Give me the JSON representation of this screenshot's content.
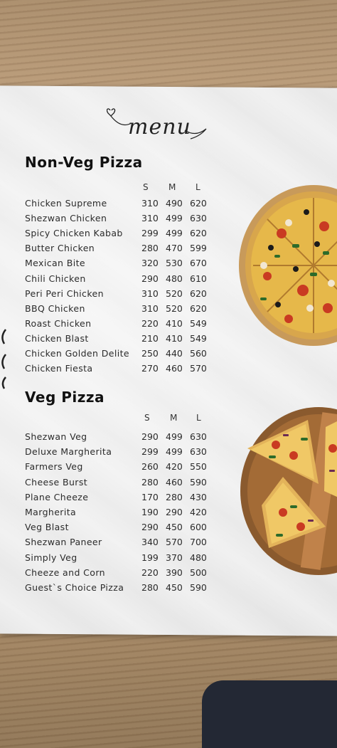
{
  "menu": {
    "title": "menu",
    "sizes": [
      "S",
      "M",
      "L"
    ],
    "non_veg": {
      "title": "Non-Veg Pizza",
      "items": [
        {
          "name": "Chicken Supreme",
          "s": "310",
          "m": "490",
          "l": "620"
        },
        {
          "name": "Shezwan Chicken",
          "s": "310",
          "m": "499",
          "l": "630"
        },
        {
          "name": "Spicy Chicken Kabab",
          "s": "299",
          "m": "499",
          "l": "620"
        },
        {
          "name": "Butter Chicken",
          "s": "280",
          "m": "470",
          "l": "599"
        },
        {
          "name": "Mexican Bite",
          "s": "320",
          "m": "530",
          "l": "670"
        },
        {
          "name": "Chili Chicken",
          "s": "290",
          "m": "480",
          "l": "610"
        },
        {
          "name": "Peri Peri Chicken",
          "s": "310",
          "m": "520",
          "l": "620"
        },
        {
          "name": "BBQ Chicken",
          "s": "310",
          "m": "520",
          "l": "620"
        },
        {
          "name": "Roast Chicken",
          "s": "220",
          "m": "410",
          "l": "549"
        },
        {
          "name": "Chicken Blast",
          "s": "210",
          "m": "410",
          "l": "549"
        },
        {
          "name": "Chicken Golden Delite",
          "s": "250",
          "m": "440",
          "l": "560"
        },
        {
          "name": "Chicken Fiesta",
          "s": "270",
          "m": "460",
          "l": "570"
        }
      ]
    },
    "veg": {
      "title": "Veg Pizza",
      "items": [
        {
          "name": "Shezwan Veg",
          "s": "290",
          "m": "499",
          "l": "630"
        },
        {
          "name": "Deluxe Margherita",
          "s": "299",
          "m": "499",
          "l": "630"
        },
        {
          "name": "Farmers Veg",
          "s": "260",
          "m": "420",
          "l": "550"
        },
        {
          "name": "Cheese Burst",
          "s": "280",
          "m": "460",
          "l": "590"
        },
        {
          "name": "Plane Cheeze",
          "s": "170",
          "m": "280",
          "l": "430"
        },
        {
          "name": "Margherita",
          "s": "190",
          "m": "290",
          "l": "420"
        },
        {
          "name": "Veg Blast",
          "s": "290",
          "m": "450",
          "l": "600"
        },
        {
          "name": "Shezwan Paneer",
          "s": "340",
          "m": "570",
          "l": "700"
        },
        {
          "name": "Simply Veg",
          "s": "199",
          "m": "370",
          "l": "480"
        },
        {
          "name": "Cheeze and Corn",
          "s": "220",
          "m": "390",
          "l": "500"
        },
        {
          "name": "Guest`s Choice Pizza",
          "s": "280",
          "m": "450",
          "l": "590"
        }
      ]
    }
  }
}
